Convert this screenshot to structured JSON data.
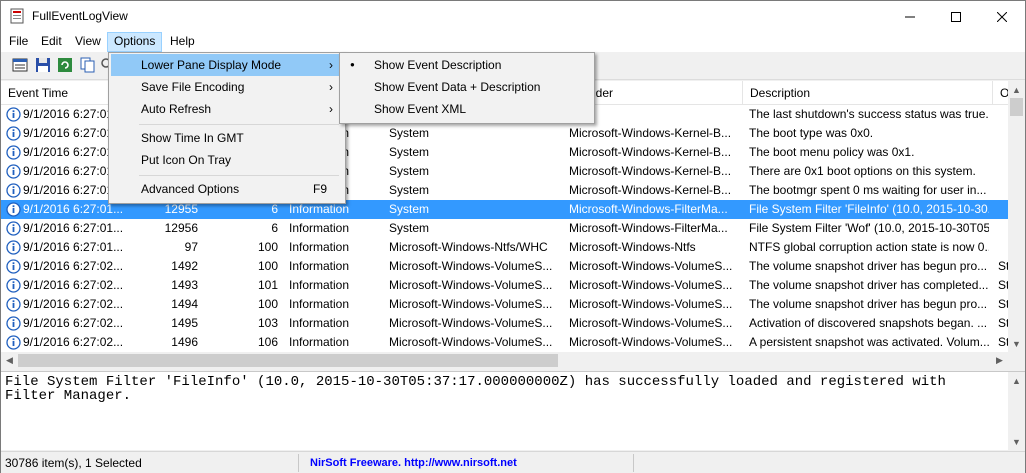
{
  "window": {
    "title": "FullEventLogView"
  },
  "menubar": {
    "items": [
      "File",
      "Edit",
      "View",
      "Options",
      "Help"
    ]
  },
  "options_menu": {
    "items": [
      {
        "label": "Lower Pane Display Mode",
        "right": "›"
      },
      {
        "label": "Save File Encoding",
        "right": "›"
      },
      {
        "label": "Auto Refresh",
        "right": "›"
      },
      {
        "label": "Show Time In GMT",
        "right": ""
      },
      {
        "label": "Put Icon On Tray",
        "right": ""
      },
      {
        "label": "Advanced Options",
        "right": "F9"
      }
    ]
  },
  "submenu": {
    "items": [
      {
        "label": "Show Event Description",
        "checked": true
      },
      {
        "label": "Show Event  Data + Description",
        "checked": false
      },
      {
        "label": "Show Event XML",
        "checked": false
      }
    ],
    "bullet": "●"
  },
  "columns": [
    "Event Time",
    "",
    "",
    "",
    "",
    "ider",
    "Description",
    "O"
  ],
  "rows": [
    {
      "time": "9/1/2016 6:27:01",
      "id": "",
      "level_num": "",
      "level": "",
      "channel": "",
      "provider": "",
      "desc": "The last shutdown's success status was true....",
      "extra": "",
      "selected": false
    },
    {
      "time": "9/1/2016 6:27:01",
      "id": "",
      "level_num": "",
      "level": "Information",
      "channel": "System",
      "provider": "Microsoft-Windows-Kernel-B...",
      "desc": "The boot type was 0x0.",
      "extra": "",
      "selected": false
    },
    {
      "time": "9/1/2016 6:27:01",
      "id": "",
      "level_num": "",
      "level": "Information",
      "channel": "System",
      "provider": "Microsoft-Windows-Kernel-B...",
      "desc": "The boot menu policy was 0x1.",
      "extra": "",
      "selected": false
    },
    {
      "time": "9/1/2016 6:27:01",
      "id": "",
      "level_num": "",
      "level": "Information",
      "channel": "System",
      "provider": "Microsoft-Windows-Kernel-B...",
      "desc": "There are 0x1 boot options on this system.",
      "extra": "",
      "selected": false
    },
    {
      "time": "9/1/2016 6:27:01",
      "id": "",
      "level_num": "",
      "level": "Information",
      "channel": "System",
      "provider": "Microsoft-Windows-Kernel-B...",
      "desc": "The bootmgr spent 0 ms waiting for user in...",
      "extra": "",
      "selected": false
    },
    {
      "time": "9/1/2016 6:27:01...",
      "id": "12955",
      "level_num": "6",
      "level": "Information",
      "channel": "System",
      "provider": "Microsoft-Windows-FilterMa...",
      "desc": "File System Filter 'FileInfo' (10.0, 2015-10-30...",
      "extra": "",
      "selected": true
    },
    {
      "time": "9/1/2016 6:27:01...",
      "id": "12956",
      "level_num": "6",
      "level": "Information",
      "channel": "System",
      "provider": "Microsoft-Windows-FilterMa...",
      "desc": "File System Filter 'Wof' (10.0, 2015-10-30T05...",
      "extra": "",
      "selected": false
    },
    {
      "time": "9/1/2016 6:27:01...",
      "id": "97",
      "level_num": "100",
      "level": "Information",
      "channel": "Microsoft-Windows-Ntfs/WHC",
      "provider": "Microsoft-Windows-Ntfs",
      "desc": "NTFS global corruption action state is now 0...",
      "extra": "",
      "selected": false
    },
    {
      "time": "9/1/2016 6:27:02...",
      "id": "1492",
      "level_num": "100",
      "level": "Information",
      "channel": "Microsoft-Windows-VolumeS...",
      "provider": "Microsoft-Windows-VolumeS...",
      "desc": "The volume snapshot driver has begun pro...",
      "extra": "St",
      "selected": false
    },
    {
      "time": "9/1/2016 6:27:02...",
      "id": "1493",
      "level_num": "101",
      "level": "Information",
      "channel": "Microsoft-Windows-VolumeS...",
      "provider": "Microsoft-Windows-VolumeS...",
      "desc": "The volume snapshot driver has completed...",
      "extra": "St",
      "selected": false
    },
    {
      "time": "9/1/2016 6:27:02...",
      "id": "1494",
      "level_num": "100",
      "level": "Information",
      "channel": "Microsoft-Windows-VolumeS...",
      "provider": "Microsoft-Windows-VolumeS...",
      "desc": "The volume snapshot driver has begun pro...",
      "extra": "St",
      "selected": false
    },
    {
      "time": "9/1/2016 6:27:02...",
      "id": "1495",
      "level_num": "103",
      "level": "Information",
      "channel": "Microsoft-Windows-VolumeS...",
      "provider": "Microsoft-Windows-VolumeS...",
      "desc": "Activation of discovered snapshots began. ...",
      "extra": "St",
      "selected": false
    },
    {
      "time": "9/1/2016 6:27:02...",
      "id": "1496",
      "level_num": "106",
      "level": "Information",
      "channel": "Microsoft-Windows-VolumeS...",
      "provider": "Microsoft-Windows-VolumeS...",
      "desc": "A persistent snapshot was activated. Volum...",
      "extra": "St",
      "selected": false
    }
  ],
  "lower_pane": {
    "text": "File System Filter 'FileInfo' (10.0, 2015-10-30T05:37:17.000000000Z) has successfully loaded and registered with Filter Manager."
  },
  "status": {
    "count": "30786 item(s), 1 Selected",
    "credit": "NirSoft Freeware.  http://www.nirsoft.net"
  },
  "colors": {
    "selection": "#3399ff",
    "menu_highlight": "#91c9f7",
    "info_icon": "#1f5fbf",
    "nirsoft_link": "#0000ff"
  }
}
